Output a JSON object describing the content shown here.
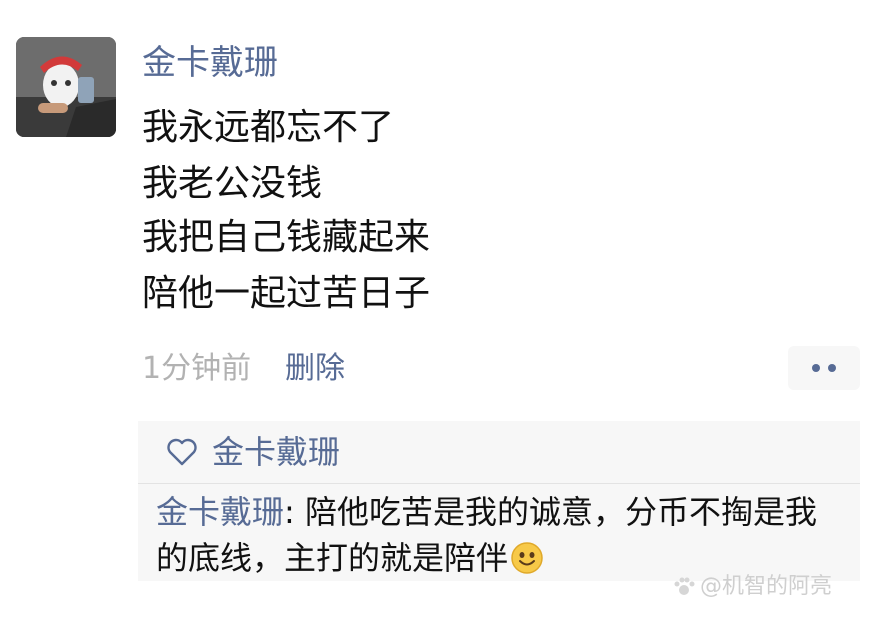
{
  "post": {
    "author": "金卡戴珊",
    "lines": [
      "我永远都忘不了",
      "我老公没钱",
      "我把自己钱藏起来",
      "陪他一起过苦日子"
    ],
    "time": "1分钟前",
    "delete_label": "删除"
  },
  "likes": {
    "names": "金卡戴珊"
  },
  "comment": {
    "author": "金卡戴珊",
    "separator": ": ",
    "text": "陪他吃苦是我的诚意，分币不掏是我的底线，主打的就是陪伴"
  },
  "watermark": {
    "text": "@机智的阿亮"
  },
  "colors": {
    "link": "#576b95",
    "meta": "#b2b2b2",
    "panel_bg": "#f7f7f7",
    "text": "#111111"
  },
  "icons": {
    "avatar": "avatar-photo",
    "like": "heart-outline-icon",
    "more": "more-dots-icon",
    "emoji": "smile-emoji-icon"
  }
}
